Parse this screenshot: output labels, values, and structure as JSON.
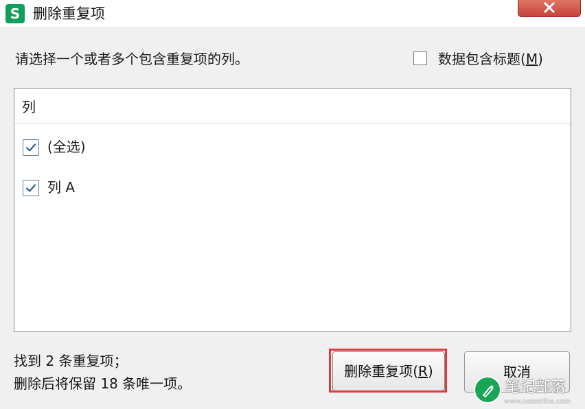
{
  "window": {
    "title": "删除重复项",
    "app_icon_letter": "S"
  },
  "instruction": "请选择一个或者多个包含重复项的列。",
  "header_option": {
    "label_prefix": "数据包含标题(",
    "accesskey": "M",
    "label_suffix": ")",
    "checked": false
  },
  "list": {
    "header": "列",
    "items": [
      {
        "label": "(全选)",
        "checked": true
      },
      {
        "label": "列 A",
        "checked": true
      }
    ]
  },
  "status": {
    "line1": "找到 2 条重复项；",
    "line2": "删除后将保留 18 条唯一项。"
  },
  "buttons": {
    "remove_prefix": "删除重复项(",
    "remove_accesskey": "R",
    "remove_suffix": ")",
    "cancel": "取消"
  },
  "watermark": {
    "name": "笔记部落",
    "url": "www.notetribe.com"
  },
  "colors": {
    "app_icon": "#0e9f5a",
    "close_button": "#c7433b",
    "highlight_outline": "#e03a3a",
    "check": "#2d5f9a",
    "watermark_logo": "#18a558"
  },
  "icons": {
    "app": "wps-spreadsheet-icon",
    "close": "close-icon",
    "check": "checkmark-icon",
    "watermark": "pen-leaf-icon"
  }
}
